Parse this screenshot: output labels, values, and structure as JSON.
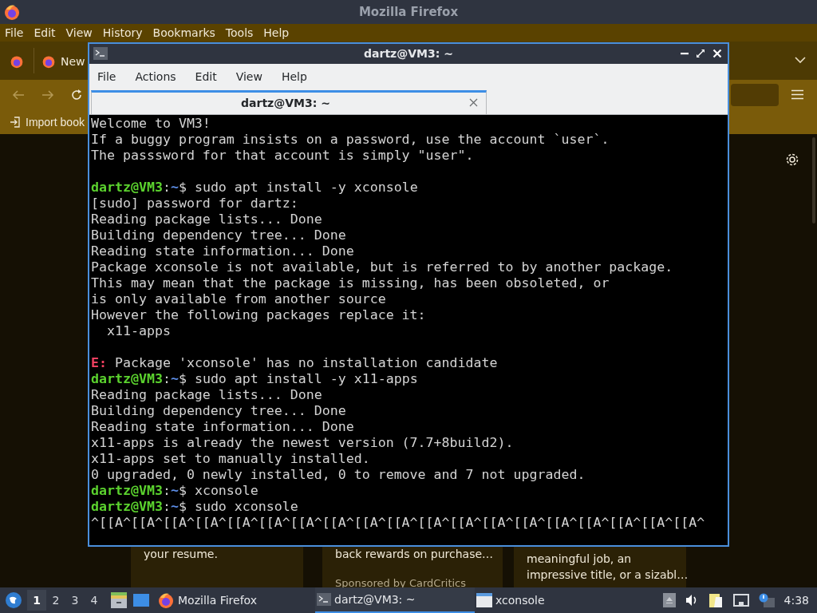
{
  "firefox": {
    "title": "Mozilla Firefox",
    "menu": [
      "File",
      "Edit",
      "View",
      "History",
      "Bookmarks",
      "Tools",
      "Help"
    ],
    "tab_label": "New",
    "bookmark": "Import book",
    "cards": [
      {
        "lines": [
          "your resume."
        ]
      },
      {
        "lines": [
          "back rewards on purchase…"
        ],
        "sponsor": "Sponsored by CardCritics"
      },
      {
        "lines": [
          "meaningful job, an",
          "impressive title, or a sizabl…"
        ]
      }
    ]
  },
  "terminal": {
    "title": "dartz@VM3: ~",
    "menu": [
      "File",
      "Actions",
      "Edit",
      "View",
      "Help"
    ],
    "tabs": [
      {
        "label": "dartz@VM3: ~",
        "selected": true
      }
    ],
    "lines": [
      {
        "kind": "output",
        "text": "Welcome to VM3!"
      },
      {
        "kind": "output",
        "text": "If a buggy program insists on a password, use the account `user`."
      },
      {
        "kind": "output",
        "text": "The passsword for that account is simply \"user\"."
      },
      {
        "kind": "blank"
      },
      {
        "kind": "prompt",
        "user": "dartz@VM3",
        "sep": ":",
        "path": "~",
        "rest": "$ sudo apt install -y xconsole"
      },
      {
        "kind": "output",
        "text": "[sudo] password for dartz:"
      },
      {
        "kind": "output",
        "text": "Reading package lists... Done"
      },
      {
        "kind": "output",
        "text": "Building dependency tree... Done"
      },
      {
        "kind": "output",
        "text": "Reading state information... Done"
      },
      {
        "kind": "output",
        "text": "Package xconsole is not available, but is referred to by another package."
      },
      {
        "kind": "output",
        "text": "This may mean that the package is missing, has been obsoleted, or"
      },
      {
        "kind": "output",
        "text": "is only available from another source"
      },
      {
        "kind": "output",
        "text": "However the following packages replace it:"
      },
      {
        "kind": "output",
        "text": "  x11-apps"
      },
      {
        "kind": "blank"
      },
      {
        "kind": "error",
        "label": "E:",
        "text": " Package 'xconsole' has no installation candidate"
      },
      {
        "kind": "prompt",
        "user": "dartz@VM3",
        "sep": ":",
        "path": "~",
        "rest": "$ sudo apt install -y x11-apps"
      },
      {
        "kind": "output",
        "text": "Reading package lists... Done"
      },
      {
        "kind": "output",
        "text": "Building dependency tree... Done"
      },
      {
        "kind": "output",
        "text": "Reading state information... Done"
      },
      {
        "kind": "output",
        "text": "x11-apps is already the newest version (7.7+8build2)."
      },
      {
        "kind": "output",
        "text": "x11-apps set to manually installed."
      },
      {
        "kind": "output",
        "text": "0 upgraded, 0 newly installed, 0 to remove and 7 not upgraded."
      },
      {
        "kind": "prompt",
        "user": "dartz@VM3",
        "sep": ":",
        "path": "~",
        "rest": "$ xconsole"
      },
      {
        "kind": "prompt",
        "user": "dartz@VM3",
        "sep": ":",
        "path": "~",
        "rest": "$ sudo xconsole"
      },
      {
        "kind": "output",
        "text": "^[[A^[[A^[[A^[[A^[[A^[[A^[[A^[[A^[[A^[[A^[[A^[[A^[[A^[[A^[[A^[[A^[[A^[[A^[[A^"
      }
    ]
  },
  "taskbar": {
    "workspaces": [
      {
        "label": "1",
        "selected": true
      },
      {
        "label": "2",
        "selected": false
      },
      {
        "label": "3",
        "selected": false
      },
      {
        "label": "4",
        "selected": false
      }
    ],
    "tasks": [
      {
        "label": "Mozilla Firefox",
        "kind": "firefox",
        "selected": false
      },
      {
        "label": "dartz@VM3: ~",
        "kind": "terminal",
        "selected": true
      },
      {
        "label": "xconsole",
        "kind": "window",
        "selected": false
      }
    ],
    "clock": "4:38"
  }
}
